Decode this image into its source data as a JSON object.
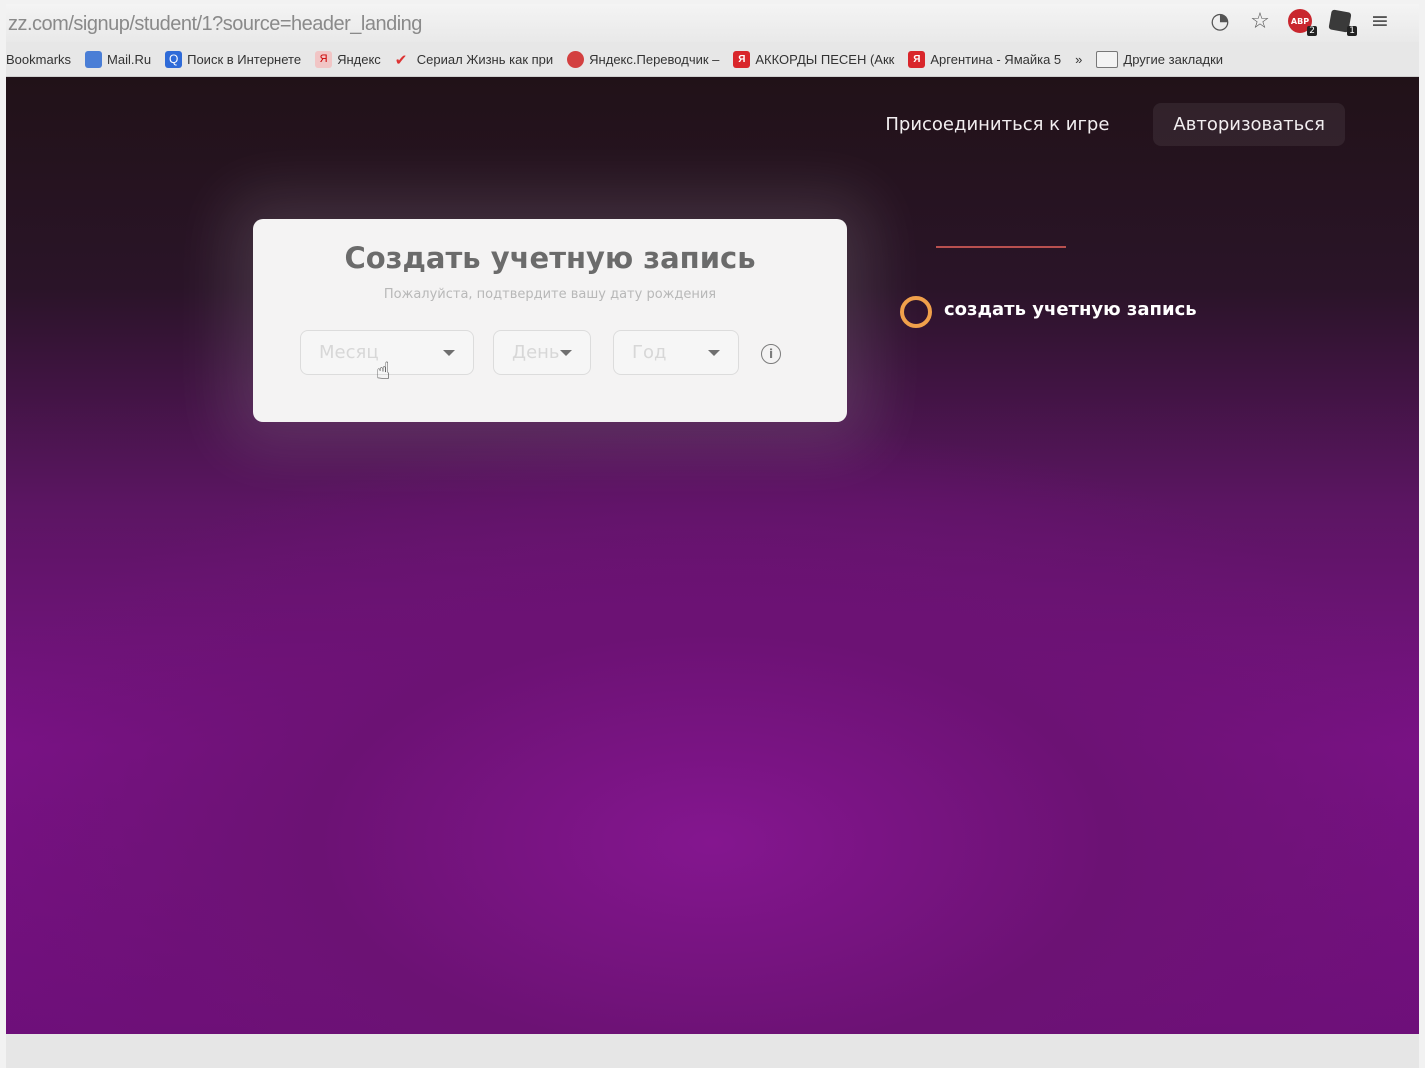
{
  "browser": {
    "url": "zz.com/signup/student/1?source=header_landing",
    "bookmarks": [
      {
        "label": "Bookmarks"
      },
      {
        "label": "Mail.Ru"
      },
      {
        "label": "Поиск в Интернете"
      },
      {
        "label": "Яндекс"
      },
      {
        "label": "Сериал Жизнь как при"
      },
      {
        "label": "Яндекс.Переводчик –"
      },
      {
        "label": "АККОРДЫ ПЕСЕН (Акк"
      },
      {
        "label": "Аргентина - Ямайка 5"
      },
      {
        "label": "»"
      },
      {
        "label": "Другие закладки"
      }
    ],
    "abp_badge": "2",
    "ext_badge": "1",
    "abp_text": "ABP"
  },
  "nav": {
    "join": "Присоединиться к игре",
    "login": "Авторизоваться"
  },
  "card": {
    "title": "Создать учетную запись",
    "subtitle": "Пожалуйста, подтвердите вашу дату рождения",
    "month_placeholder": "Месяц",
    "day_placeholder": "День",
    "year_placeholder": "Год",
    "info": "i"
  },
  "steps": {
    "step_label": "создать учетную запись"
  }
}
